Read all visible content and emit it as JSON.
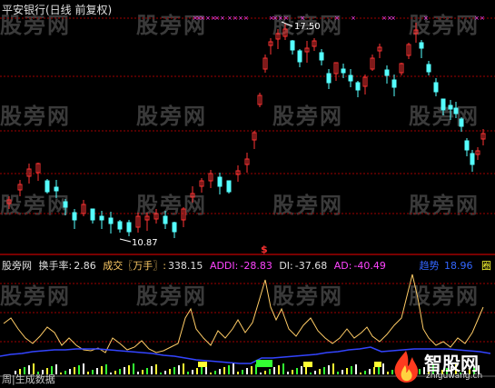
{
  "header": {
    "title": "平安银行(日线 前复权)"
  },
  "main_chart": {
    "high_label": "17.50",
    "low_label": "10.87"
  },
  "indicator": {
    "brand": "股旁网",
    "turnover_label": "换手率:",
    "turnover_value": "2.86",
    "volume_label": "成交〖万手〗:",
    "volume_value": "338.15",
    "addi_label": "ADDI:",
    "addi_value": "-28.83",
    "di_label": "DI:",
    "di_value": "-37.68",
    "ad_label": "AD:",
    "ad_value": "-40.49",
    "tag_trend": "趋势",
    "tag_value": "18.96",
    "tag_circle": "圈"
  },
  "footer": {
    "bottom_left": "周|生成数据",
    "logo_name": "智股网",
    "logo_url": "zhiguwang.cn"
  },
  "watermark": {
    "text": "股旁网"
  },
  "colors": {
    "background": "#000000",
    "candle_up": "#ff3333",
    "candle_down": "#55ffff",
    "dotted_grid": "#a00000",
    "orange_line": "#ffcc66",
    "blue_line": "#3344ff",
    "magenta": "#ff44ff",
    "yellow": "#ffff33",
    "green": "#33ff33"
  },
  "icons": [
    "fire-logo-icon",
    "signal-s-icon",
    "star-mark-icon"
  ]
}
